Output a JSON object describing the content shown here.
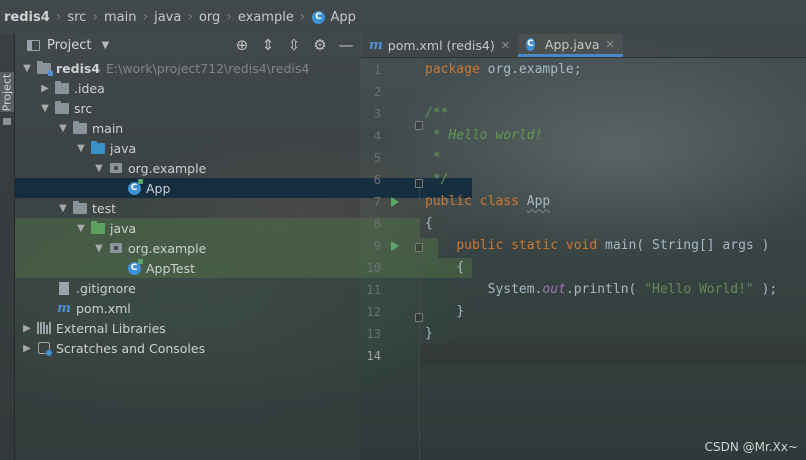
{
  "breadcrumb": [
    "redis4",
    "src",
    "main",
    "java",
    "org",
    "example",
    "App"
  ],
  "sidebar_stripe": {
    "label": "Project"
  },
  "project_panel": {
    "title": "Project",
    "tree": [
      {
        "label": "redis4",
        "path": "E:\\work\\project712\\redis4\\redis4"
      },
      {
        "label": ".idea"
      },
      {
        "label": "src"
      },
      {
        "label": "main"
      },
      {
        "label": "java"
      },
      {
        "label": "org.example"
      },
      {
        "label": "App"
      },
      {
        "label": "test"
      },
      {
        "label": "java"
      },
      {
        "label": "org.example"
      },
      {
        "label": "AppTest"
      },
      {
        "label": ".gitignore"
      },
      {
        "label": "pom.xml"
      },
      {
        "label": "External Libraries"
      },
      {
        "label": "Scratches and Consoles"
      }
    ]
  },
  "editor": {
    "tabs": [
      {
        "label": "pom.xml (redis4)"
      },
      {
        "label": "App.java"
      }
    ],
    "line_numbers": [
      "1",
      "2",
      "3",
      "4",
      "5",
      "6",
      "7",
      "8",
      "9",
      "10",
      "11",
      "12",
      "13",
      "14"
    ],
    "code": {
      "l1_kw": "package",
      "l1_rest": " org.example;",
      "l3": "/**",
      "l4": " * Hello world!",
      "l5": " *",
      "l6": " */",
      "l7_kw": "public class",
      "l7_name": "App",
      "l8": "{",
      "l9_kw": "public static void",
      "l9_rest": " main( String[] args )",
      "l10": "{",
      "l11_a": "System.",
      "l11_field": "out",
      "l11_b": ".println( ",
      "l11_str": "\"Hello World!\"",
      "l11_c": " );",
      "l12": "}",
      "l13": "}"
    }
  },
  "watermark": "CSDN @Mr.Xx~",
  "colors": {
    "keyword": "#cc7832",
    "comment": "#629755",
    "string": "#6a8759",
    "selection": "#0d293e",
    "accent": "#4a88c7"
  }
}
